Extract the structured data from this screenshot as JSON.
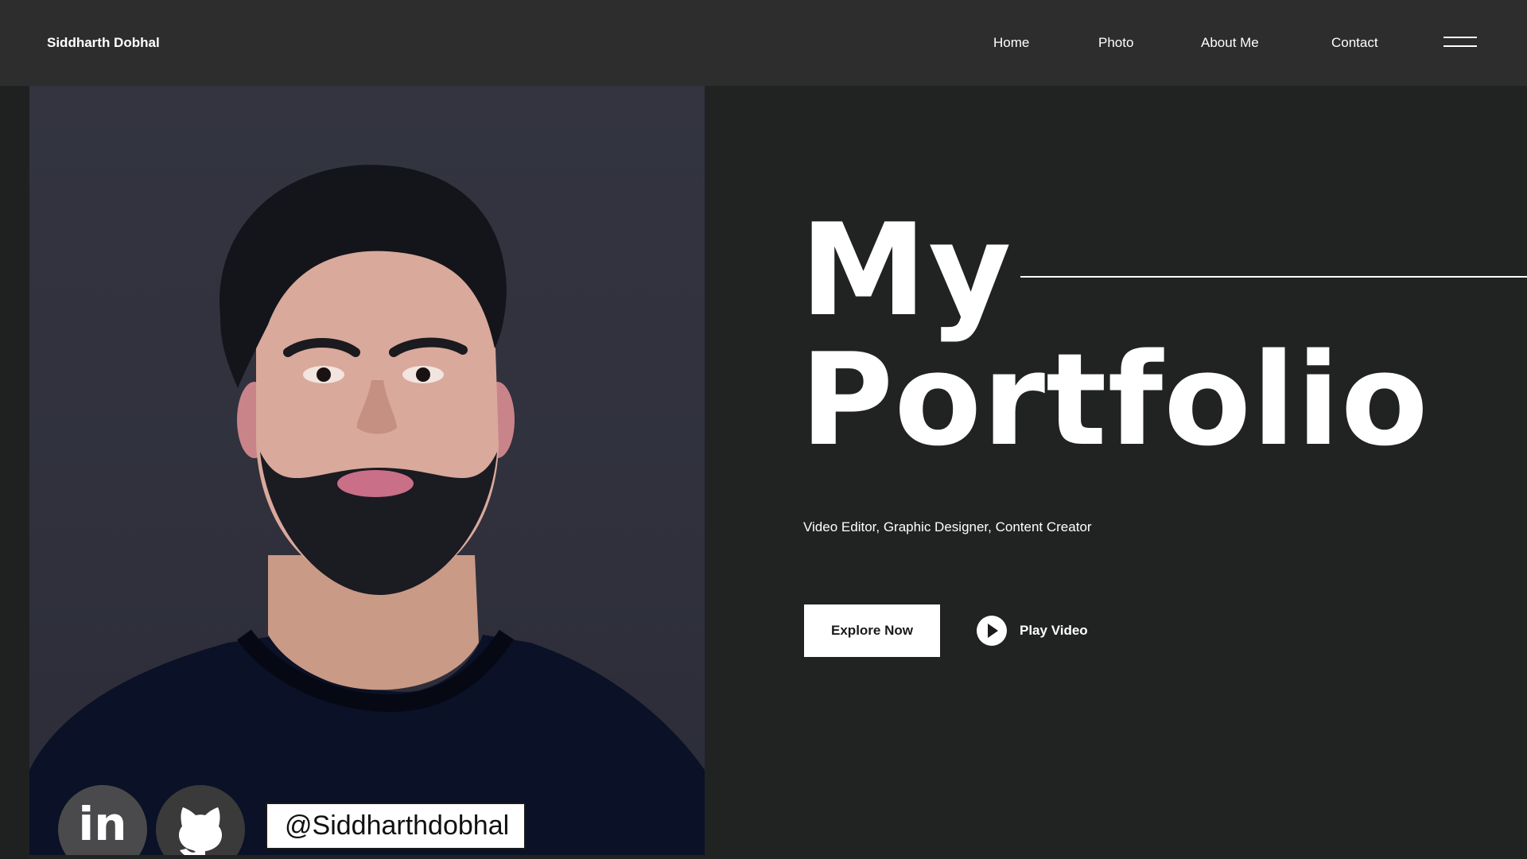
{
  "header": {
    "brand": "Siddharth Dobhal",
    "nav": [
      "Home",
      "Photo",
      "About Me",
      "Contact"
    ],
    "menu_icon": "hamburger-icon"
  },
  "photo": {
    "subject": "portrait-photo",
    "socials": [
      {
        "icon": "linkedin-icon",
        "glyph": "in"
      },
      {
        "icon": "github-icon"
      }
    ],
    "handle": "@Siddharthdobhal"
  },
  "hero": {
    "title_line1": "My",
    "title_line2": "Portfolio",
    "subtitle": "Video Editor, Graphic Designer, Content Creator",
    "explore_label": "Explore Now",
    "play_label": "Play Video",
    "play_icon": "play-icon"
  },
  "colors": {
    "page_bg": "#212222",
    "header_bg": "#2d2d2e",
    "text": "#ffffff",
    "button_bg": "#ffffff",
    "button_text": "#1a1a1a"
  }
}
